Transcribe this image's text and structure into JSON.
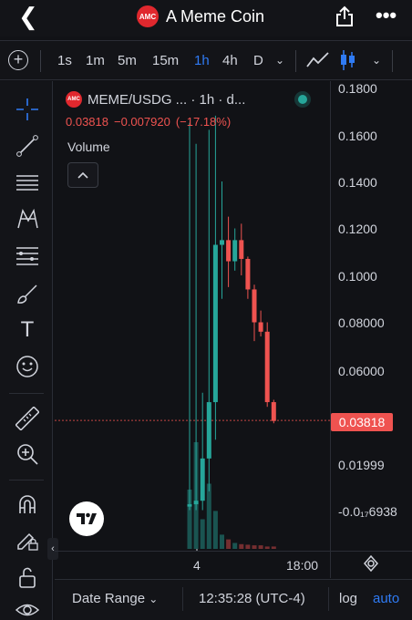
{
  "header": {
    "logo_text": "AMC",
    "title": "A Meme Coin"
  },
  "toolbar": {
    "intervals": [
      "1s",
      "1m",
      "5m",
      "15m",
      "1h",
      "4h",
      "D"
    ],
    "active_interval": "1h"
  },
  "symbol": {
    "title": "MEME/USDG ... · 1h · d...",
    "logo_text": "AMC",
    "last_price": "0.03818",
    "change": "−0.007920",
    "change_pct": "(−17.18%)"
  },
  "indicator": {
    "volume_label": "Volume"
  },
  "price_axis": {
    "labels": [
      "0.1800",
      "0.1600",
      "0.1400",
      "0.1200",
      "0.1000",
      "0.08000",
      "0.06000",
      "0.03818",
      "0.01999",
      "-0.0₁₇6938"
    ],
    "current_price": "0.03818"
  },
  "time_axis": {
    "labels": [
      "4",
      "18:00"
    ]
  },
  "bottom_bar": {
    "date_range": "Date Range",
    "clock": "12:35:28 (UTC-4)",
    "log": "log",
    "auto": "auto"
  },
  "colors": {
    "up": "#26a69a",
    "down": "#ef5350",
    "accent": "#2f7bf5",
    "background": "#111216"
  },
  "chart_data": {
    "type": "candlestick",
    "interval": "1h",
    "y_axis_ticks": [
      0.18,
      0.16,
      0.14,
      0.12,
      0.1,
      0.08,
      0.06,
      0.03818,
      0.01999
    ],
    "ylim": [
      -0.02,
      0.185
    ],
    "last_price": 0.03818,
    "candles": [
      {
        "o": 0.0015,
        "h": 0.165,
        "l": 0.0,
        "c": 0.0025
      },
      {
        "o": 0.0025,
        "h": 0.156,
        "l": 0.0,
        "c": 0.004
      },
      {
        "o": 0.004,
        "h": 0.05,
        "l": 0.0,
        "c": 0.022
      },
      {
        "o": 0.022,
        "h": 0.162,
        "l": 0.008,
        "c": 0.046
      },
      {
        "o": 0.046,
        "h": 0.168,
        "l": 0.03,
        "c": 0.113
      },
      {
        "o": 0.113,
        "h": 0.14,
        "l": 0.09,
        "c": 0.115
      },
      {
        "o": 0.115,
        "h": 0.125,
        "l": 0.095,
        "c": 0.106
      },
      {
        "o": 0.106,
        "h": 0.12,
        "l": 0.102,
        "c": 0.115
      },
      {
        "o": 0.115,
        "h": 0.122,
        "l": 0.1,
        "c": 0.107
      },
      {
        "o": 0.107,
        "h": 0.108,
        "l": 0.09,
        "c": 0.094
      },
      {
        "o": 0.094,
        "h": 0.096,
        "l": 0.072,
        "c": 0.08
      },
      {
        "o": 0.08,
        "h": 0.085,
        "l": 0.074,
        "c": 0.076
      },
      {
        "o": 0.076,
        "h": 0.08,
        "l": 0.044,
        "c": 0.046
      },
      {
        "o": 0.046,
        "h": 0.047,
        "l": 0.037,
        "c": 0.038
      }
    ],
    "volumes": [
      0.5,
      0.9,
      0.25,
      0.55,
      0.32,
      0.12,
      0.08,
      0.05,
      0.04,
      0.035,
      0.03,
      0.03,
      0.02,
      0.02
    ]
  }
}
